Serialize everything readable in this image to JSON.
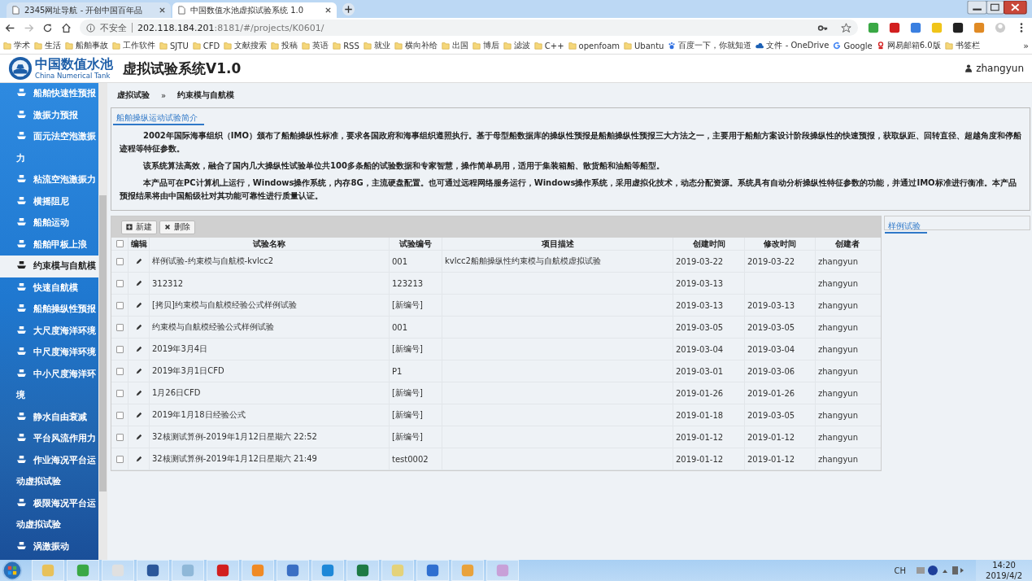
{
  "browser": {
    "tabs": [
      {
        "title": "2345网址导航 - 开创中国百年品",
        "selected": false
      },
      {
        "title": "中国数值水池虚拟试验系统 1.0",
        "selected": true
      }
    ],
    "security": "不安全",
    "url_host": "202.118.184.201",
    "url_rest": ":8181/#/projects/K0601/",
    "bookmarks": [
      {
        "label": "学术",
        "kind": "folder"
      },
      {
        "label": "生活",
        "kind": "folder"
      },
      {
        "label": "船舶事故",
        "kind": "folder"
      },
      {
        "label": "工作软件",
        "kind": "folder"
      },
      {
        "label": "SJTU",
        "kind": "folder"
      },
      {
        "label": "CFD",
        "kind": "folder"
      },
      {
        "label": "文献搜索",
        "kind": "folder"
      },
      {
        "label": "投稿",
        "kind": "folder"
      },
      {
        "label": "英语",
        "kind": "folder"
      },
      {
        "label": "RSS",
        "kind": "folder"
      },
      {
        "label": "就业",
        "kind": "folder"
      },
      {
        "label": "横向补给",
        "kind": "folder"
      },
      {
        "label": "出国",
        "kind": "folder"
      },
      {
        "label": "博后",
        "kind": "folder"
      },
      {
        "label": "滤波",
        "kind": "folder"
      },
      {
        "label": "C++",
        "kind": "folder"
      },
      {
        "label": "openfoam",
        "kind": "folder"
      },
      {
        "label": "Ubantu",
        "kind": "folder"
      },
      {
        "label": "百度一下，你就知道",
        "kind": "paw"
      },
      {
        "label": "文件 - OneDrive",
        "kind": "cloud"
      },
      {
        "label": "Google",
        "kind": "g"
      },
      {
        "label": "网易邮箱6.0版",
        "kind": "mail"
      },
      {
        "label": "书签栏",
        "kind": "folder"
      }
    ],
    "more": "»"
  },
  "header": {
    "logo_name": "中国数值水池",
    "logo_subtitle": "China Numerical Tank",
    "title": "虚拟试验系统V1.0",
    "user": "zhangyun"
  },
  "sidebar": {
    "items": [
      {
        "label": "船舶快速性预报",
        "selected": false
      },
      {
        "label": "激振力预报",
        "selected": false
      },
      {
        "label": "面元法空泡激振力",
        "selected": false
      },
      {
        "label": "粘流空泡激振力",
        "selected": false
      },
      {
        "label": "横摇阻尼",
        "selected": false
      },
      {
        "label": "船舶运动",
        "selected": false
      },
      {
        "label": "船舶甲板上浪",
        "selected": false
      },
      {
        "label": "约束模与自航模",
        "selected": true
      },
      {
        "label": "快速自航模",
        "selected": false
      },
      {
        "label": "船舶操纵性预报",
        "selected": false
      },
      {
        "label": "大尺度海洋环境",
        "selected": false
      },
      {
        "label": "中尺度海洋环境",
        "selected": false
      },
      {
        "label": "中小尺度海洋环境",
        "selected": false
      },
      {
        "label": "静水自由衰减",
        "selected": false
      },
      {
        "label": "平台风流作用力",
        "selected": false
      },
      {
        "label": "作业海况平台运动虚拟试验",
        "selected": false
      },
      {
        "label": "极限海况平台运动虚拟试验",
        "selected": false
      },
      {
        "label": "涡激振动",
        "selected": false
      }
    ]
  },
  "breadcrumb": {
    "items": [
      "虚拟试验",
      "约束模与自航模"
    ],
    "separator": "»"
  },
  "intro": {
    "title": "船舶操纵运动试验简介",
    "paragraphs": [
      "2002年国际海事组织（IMO）颁布了船舶操纵性标准，要求各国政府和海事组织遵照执行。基于母型船数据库的操纵性预报是船舶操纵性预报三大方法之一，主要用于船舶方案设计阶段操纵性的快速预报，获取纵距、回转直径、超越角度和停船迹程等特征参数。",
      "该系统算法高效，融合了国内几大操纵性试验单位共100多条船的试验数据和专家智慧，操作简单易用，适用于集装箱船、散货船和油船等船型。",
      "本产品可在PC计算机上运行，Windows操作系统，内存8G，主流硬盘配置。也可通过远程网络服务运行，Windows操作系统，采用虚拟化技术，动态分配资源。系统具有自动分析操纵性特征参数的功能，并通过IMO标准进行衡准。本产品预报结果将由中国船级社对其功能可靠性进行质量认证。"
    ]
  },
  "toolbar": [
    {
      "label": "新建",
      "kind": "add"
    },
    {
      "label": "删除",
      "kind": "delete"
    }
  ],
  "table": {
    "all_checked": false,
    "columns": [
      "编辑",
      "试验名称",
      "试验编号",
      "项目描述",
      "创建时间",
      "修改时间",
      "创建者"
    ],
    "rows": [
      {
        "checked": false,
        "cells": [
          "",
          "样例试验-约束模与自航模-kvlcc2",
          "001",
          "kvlcc2船舶操纵性约束模与自航模虚拟试验",
          "2019-03-22",
          "2019-03-22",
          "zhangyun"
        ]
      },
      {
        "checked": false,
        "cells": [
          "",
          "312312",
          "123213",
          "",
          "2019-03-13",
          "",
          "zhangyun"
        ]
      },
      {
        "checked": false,
        "cells": [
          "",
          "[拷贝]约束模与自航模经验公式样例试验",
          "[新编号]",
          "",
          "2019-03-13",
          "2019-03-13",
          "zhangyun"
        ]
      },
      {
        "checked": false,
        "cells": [
          "",
          "约束模与自航模经验公式样例试验",
          "001",
          "",
          "2019-03-05",
          "2019-03-05",
          "zhangyun"
        ]
      },
      {
        "checked": false,
        "cells": [
          "",
          "2019年3月4日",
          "[新编号]",
          "",
          "2019-03-04",
          "2019-03-04",
          "zhangyun"
        ]
      },
      {
        "checked": false,
        "cells": [
          "",
          "2019年3月1日CFD",
          "P1",
          "",
          "2019-03-01",
          "2019-03-06",
          "zhangyun"
        ]
      },
      {
        "checked": false,
        "cells": [
          "",
          "1月26日CFD",
          "[新编号]",
          "",
          "2019-01-26",
          "2019-01-26",
          "zhangyun"
        ]
      },
      {
        "checked": false,
        "cells": [
          "",
          "2019年1月18日经验公式",
          "[新编号]",
          "",
          "2019-01-18",
          "2019-03-05",
          "zhangyun"
        ]
      },
      {
        "checked": false,
        "cells": [
          "",
          "32核测试算例-2019年1月12日星期六 22:52",
          "[新编号]",
          "",
          "2019-01-12",
          "2019-01-12",
          "zhangyun"
        ]
      },
      {
        "checked": false,
        "cells": [
          "",
          "32核测试算例-2019年1月12日星期六 21:49",
          "test0002",
          "",
          "2019-01-12",
          "2019-01-12",
          "zhangyun"
        ]
      }
    ]
  },
  "side_panel": {
    "tab": "样例试验"
  },
  "taskbar": {
    "input": "CH",
    "time": "14:20",
    "date": "2019/4/2"
  }
}
